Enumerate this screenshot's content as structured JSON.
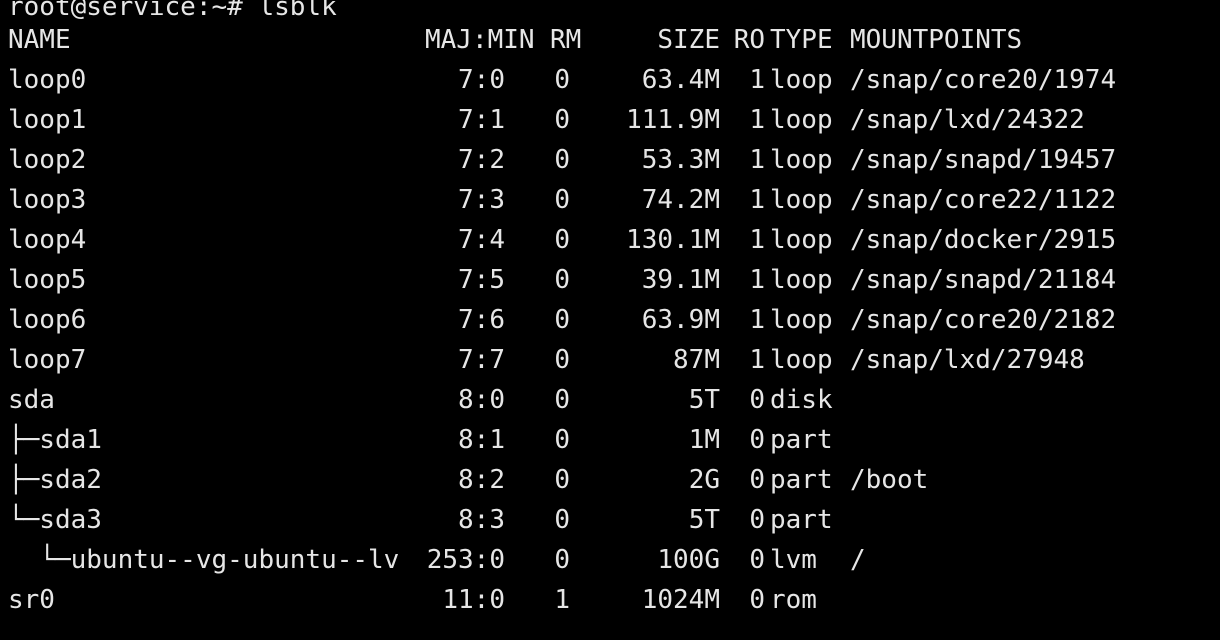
{
  "prompt": {
    "user_host": "root@service:~#",
    "command": "lsblk"
  },
  "headers": {
    "name": "NAME",
    "majmin": "MAJ:MIN",
    "rm": "RM",
    "size": "SIZE",
    "ro": "RO",
    "type": "TYPE",
    "mountpoints": "MOUNTPOINTS"
  },
  "rows": [
    {
      "name": "loop0",
      "majmin": "7:0",
      "rm": "0",
      "size": "63.4M",
      "ro": "1",
      "type": "loop",
      "mount": "/snap/core20/1974"
    },
    {
      "name": "loop1",
      "majmin": "7:1",
      "rm": "0",
      "size": "111.9M",
      "ro": "1",
      "type": "loop",
      "mount": "/snap/lxd/24322"
    },
    {
      "name": "loop2",
      "majmin": "7:2",
      "rm": "0",
      "size": "53.3M",
      "ro": "1",
      "type": "loop",
      "mount": "/snap/snapd/19457"
    },
    {
      "name": "loop3",
      "majmin": "7:3",
      "rm": "0",
      "size": "74.2M",
      "ro": "1",
      "type": "loop",
      "mount": "/snap/core22/1122"
    },
    {
      "name": "loop4",
      "majmin": "7:4",
      "rm": "0",
      "size": "130.1M",
      "ro": "1",
      "type": "loop",
      "mount": "/snap/docker/2915"
    },
    {
      "name": "loop5",
      "majmin": "7:5",
      "rm": "0",
      "size": "39.1M",
      "ro": "1",
      "type": "loop",
      "mount": "/snap/snapd/21184"
    },
    {
      "name": "loop6",
      "majmin": "7:6",
      "rm": "0",
      "size": "63.9M",
      "ro": "1",
      "type": "loop",
      "mount": "/snap/core20/2182"
    },
    {
      "name": "loop7",
      "majmin": "7:7",
      "rm": "0",
      "size": "87M",
      "ro": "1",
      "type": "loop",
      "mount": "/snap/lxd/27948"
    },
    {
      "name": "sda",
      "majmin": "8:0",
      "rm": "0",
      "size": "5T",
      "ro": "0",
      "type": "disk",
      "mount": ""
    },
    {
      "name": "├─sda1",
      "majmin": "8:1",
      "rm": "0",
      "size": "1M",
      "ro": "0",
      "type": "part",
      "mount": ""
    },
    {
      "name": "├─sda2",
      "majmin": "8:2",
      "rm": "0",
      "size": "2G",
      "ro": "0",
      "type": "part",
      "mount": "/boot"
    },
    {
      "name": "└─sda3",
      "majmin": "8:3",
      "rm": "0",
      "size": "5T",
      "ro": "0",
      "type": "part",
      "mount": ""
    },
    {
      "name": "  └─ubuntu--vg-ubuntu--lv",
      "majmin": "253:0",
      "rm": "0",
      "size": "100G",
      "ro": "0",
      "type": "lvm",
      "mount": "/"
    },
    {
      "name": "sr0",
      "majmin": "11:0",
      "rm": "1",
      "size": "1024M",
      "ro": "0",
      "type": "rom",
      "mount": ""
    }
  ]
}
